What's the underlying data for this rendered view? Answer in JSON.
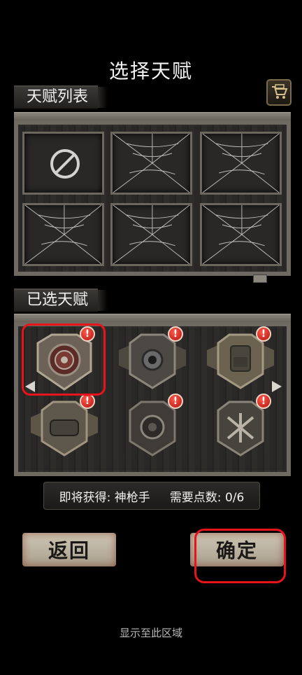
{
  "header": {
    "title": "选择天赋"
  },
  "talent_list": {
    "label": "天赋列表"
  },
  "selected_talents": {
    "label": "已选天赋"
  },
  "cart": {
    "icon": "shopping-cart-icon"
  },
  "slots": [
    {
      "state": "empty",
      "icon": "ban-icon"
    },
    {
      "state": "locked",
      "icon": "cobweb-icon"
    },
    {
      "state": "locked",
      "icon": "cobweb-icon"
    },
    {
      "state": "locked",
      "icon": "cobweb-icon"
    },
    {
      "state": "locked",
      "icon": "cobweb-icon"
    },
    {
      "state": "locked",
      "icon": "cobweb-icon"
    }
  ],
  "talents": [
    {
      "icon": "target-shield-icon",
      "badge": "!"
    },
    {
      "icon": "eye-icon",
      "badge": "!"
    },
    {
      "icon": "backpack-icon",
      "badge": "!"
    },
    {
      "icon": "bag-icon",
      "badge": "!"
    },
    {
      "icon": "core-icon",
      "badge": "!"
    },
    {
      "icon": "crossed-arrows-icon",
      "badge": "!"
    }
  ],
  "info": {
    "gain": "即将获得: 神枪手",
    "points": "需要点数: 0/6"
  },
  "buttons": {
    "back": "返回",
    "confirm": "确定"
  },
  "footer": {
    "hint": "显示至此区域"
  },
  "colors": {
    "highlight": "#e8141b",
    "badge": "#c8201a"
  }
}
